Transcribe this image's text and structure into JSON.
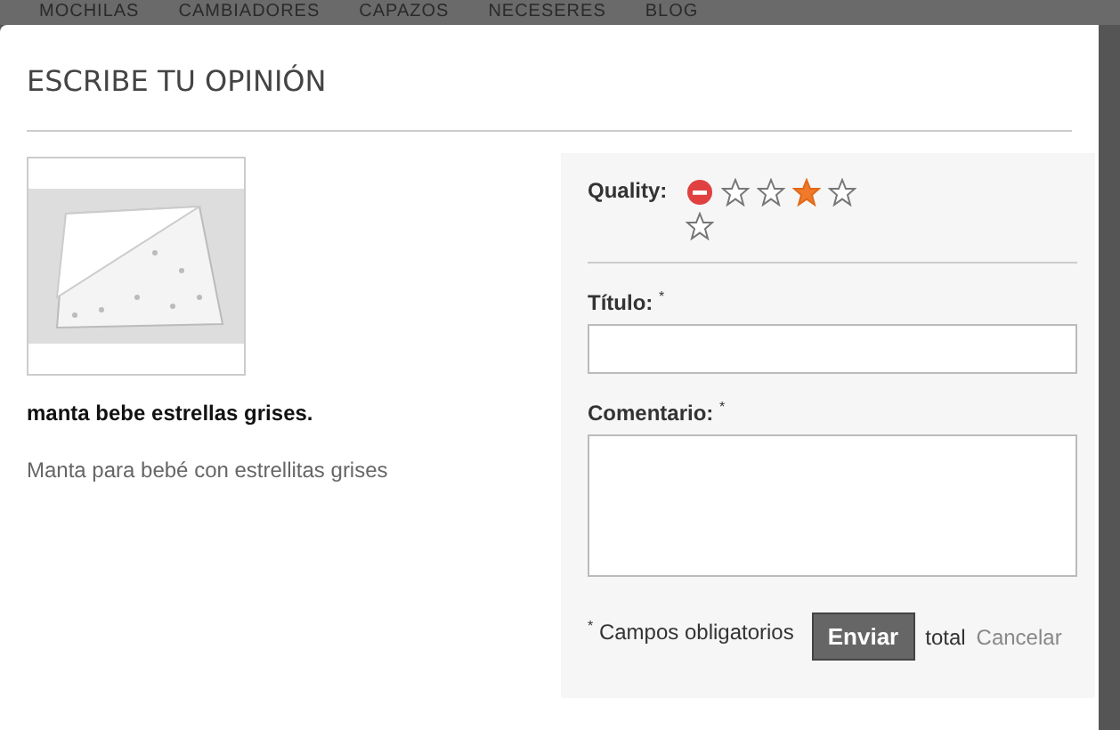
{
  "background_nav": [
    "MOCHILAS",
    "CAMBIADORES",
    "CAPAZOS",
    "NECESERES",
    "BLOG"
  ],
  "modal": {
    "title": "ESCRIBE TU OPINIÓN"
  },
  "product": {
    "name": "manta bebe estrellas grises.",
    "description": "Manta para bebé con estrellitas grises"
  },
  "form": {
    "rating": {
      "label": "Quality:",
      "stars": [
        {
          "selected": false
        },
        {
          "selected": false
        },
        {
          "selected": true
        },
        {
          "selected": false
        },
        {
          "selected": false
        }
      ]
    },
    "fields": [
      {
        "label": "Título:",
        "required_mark": "*",
        "kind": "text"
      },
      {
        "label": "Comentario:",
        "required_mark": "*",
        "kind": "textarea"
      }
    ],
    "footer": {
      "required_mark": "*",
      "required_note": "Campos obligatorios",
      "submit": "Enviar",
      "total": "total",
      "cancel": "Cancelar"
    }
  }
}
